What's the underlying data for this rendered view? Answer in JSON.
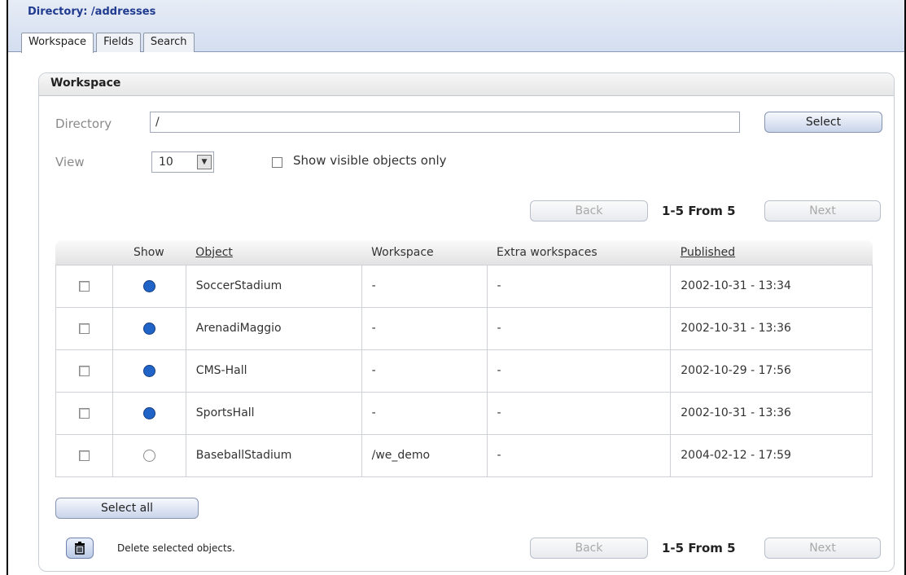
{
  "header": {
    "directory_title": "Directory: /addresses",
    "tabs": [
      {
        "label": "Workspace",
        "active": true
      },
      {
        "label": "Fields",
        "active": false
      },
      {
        "label": "Search",
        "active": false
      }
    ]
  },
  "panel": {
    "title": "Workspace",
    "directory_label": "Directory",
    "directory_value": "/",
    "select_button": "Select",
    "view_label": "View",
    "view_value": "10",
    "show_visible_label": "Show visible objects only"
  },
  "pager": {
    "back": "Back",
    "next": "Next",
    "range": "1-5 From 5"
  },
  "table": {
    "headers": [
      "",
      "Show",
      "Object",
      "Workspace",
      "Extra workspaces",
      "Published"
    ],
    "rows": [
      {
        "show": "visible",
        "object": "SoccerStadium",
        "workspace": "-",
        "extra": "-",
        "published": "2002-10-31 - 13:34"
      },
      {
        "show": "visible",
        "object": "ArenadiMaggio",
        "workspace": "-",
        "extra": "-",
        "published": "2002-10-31 - 13:36"
      },
      {
        "show": "visible",
        "object": "CMS-Hall",
        "workspace": "-",
        "extra": "-",
        "published": "2002-10-29 - 17:56"
      },
      {
        "show": "visible",
        "object": "SportsHall",
        "workspace": "-",
        "extra": "-",
        "published": "2002-10-31 - 13:36"
      },
      {
        "show": "hidden",
        "object": "BaseballStadium",
        "workspace": "/we_demo",
        "extra": "-",
        "published": "2004-02-12 - 17:59"
      }
    ]
  },
  "footer": {
    "select_all": "Select all",
    "trash_icon": "trash-icon",
    "delete_text": "Delete selected objects."
  },
  "colors": {
    "header_bg": "#d3def0",
    "title_blue": "#1f3a8f",
    "dot_visible": "#1f64c6"
  }
}
